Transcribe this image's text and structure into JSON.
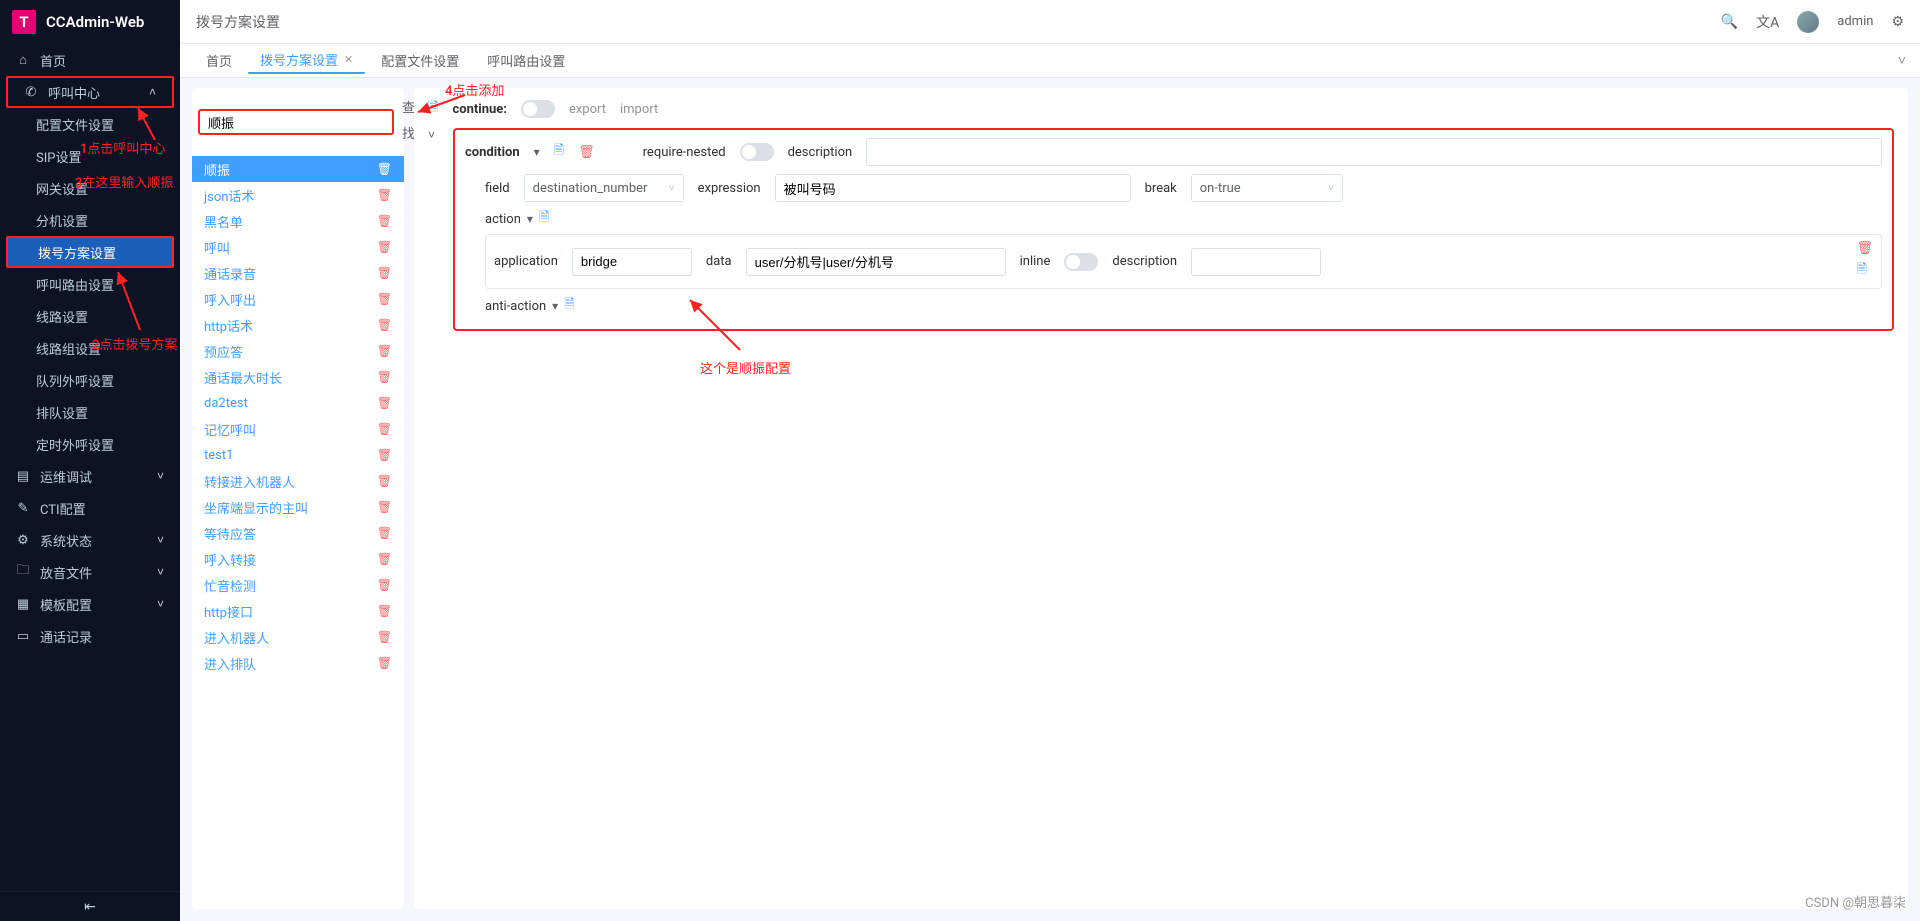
{
  "app_name": "CCAdmin-Web",
  "header": {
    "title": "拨号方案设置",
    "username": "admin"
  },
  "sidebar": {
    "home": "首页",
    "call_center": "呼叫中心",
    "items": [
      "配置文件设置",
      "SIP设置",
      "网关设置",
      "分机设置",
      "拨号方案设置",
      "呼叫路由设置",
      "线路设置",
      "线路组设置",
      "队列外呼设置",
      "排队设置",
      "定时外呼设置"
    ],
    "groups": [
      "运维调试",
      "CTI配置",
      "系统状态",
      "放音文件",
      "模板配置",
      "通话记录"
    ]
  },
  "tabs": {
    "items": [
      {
        "label": "首页",
        "closable": false,
        "active": false
      },
      {
        "label": "拨号方案设置",
        "closable": true,
        "active": true
      },
      {
        "label": "配置文件设置",
        "closable": false,
        "active": false
      },
      {
        "label": "呼叫路由设置",
        "closable": false,
        "active": false
      }
    ]
  },
  "left_panel": {
    "search_value": "顺振",
    "find_label": "查找",
    "add_label": "添加",
    "list": [
      "顺振",
      "json话术",
      "黑名单",
      "呼叫",
      "通话录音",
      "呼入呼出",
      "http话术",
      "预应答",
      "通话最大时长",
      "da2test",
      "记忆呼叫",
      "test1",
      "转接进入机器人",
      "坐席端显示的主叫",
      "等待应答",
      "呼入转接",
      "忙音检测",
      "http接口",
      "进入机器人",
      "进入排队"
    ]
  },
  "right_panel": {
    "continue_label": "continue:",
    "export_label": "export",
    "import_label": "import",
    "condition_label": "condition",
    "require_nested_label": "require-nested",
    "description_label": "description",
    "field_label": "field",
    "field_value": "destination_number",
    "expression_label": "expression",
    "expression_value": "被叫号码",
    "break_label": "break",
    "break_value": "on-true",
    "action_label": "action",
    "application_label": "application",
    "application_value": "bridge",
    "data_label": "data",
    "data_value": "user/分机号|user/分机号",
    "inline_label": "inline",
    "anti_action_label": "anti-action"
  },
  "annotations": {
    "a1": "1点击呼叫中心",
    "a2": "2点击拨号方案",
    "a3": "3在这里输入顺振",
    "a4": "4点击添加",
    "a5": "这个是顺振配置"
  },
  "watermark": "CSDN @朝思暮柒"
}
